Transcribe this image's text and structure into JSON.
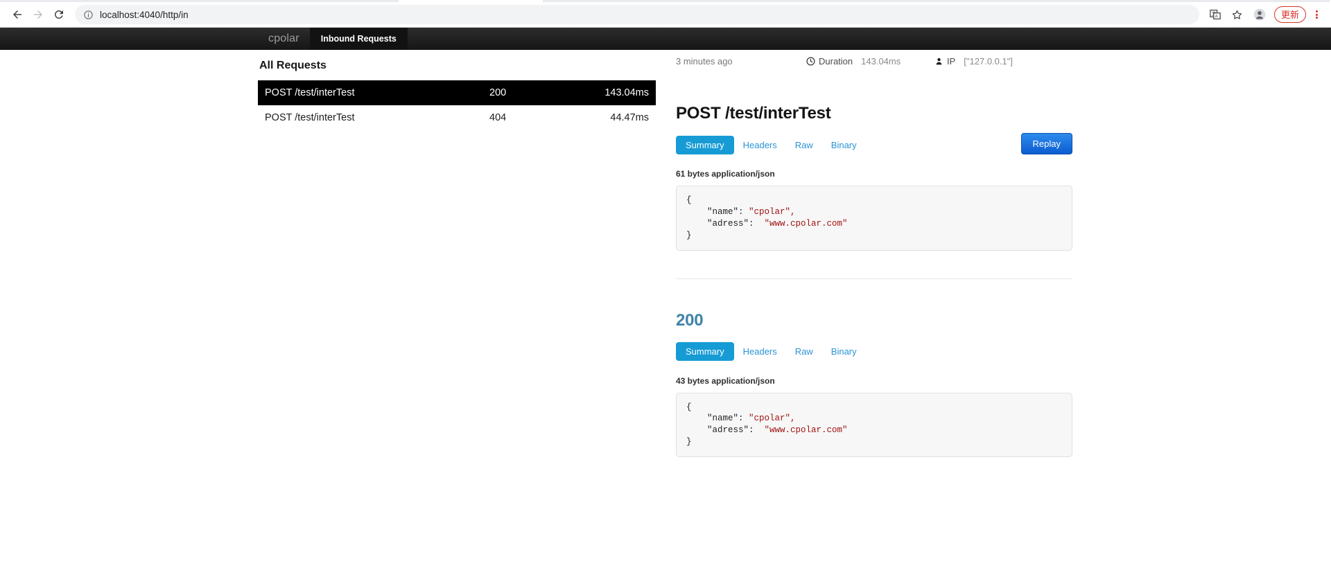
{
  "browser": {
    "url": "localhost:4040/http/in",
    "back_label": "Back",
    "forward_label": "Forward",
    "reload_label": "Reload",
    "site_info_label": "View site information",
    "translate_label": "Translate this page",
    "bookmark_label": "Bookmark this tab",
    "profile_label": "Profile",
    "update_label": "更新",
    "menu_label": "Customize and control"
  },
  "navbar": {
    "brand": "cpolar",
    "tab_inbound": "Inbound Requests"
  },
  "requests": {
    "title": "All Requests",
    "rows": [
      {
        "path": "POST /test/interTest",
        "status": "200",
        "duration": "143.04ms",
        "selected": true
      },
      {
        "path": "POST /test/interTest",
        "status": "404",
        "duration": "44.47ms",
        "selected": false
      }
    ]
  },
  "detail": {
    "meta": {
      "when": "3 minutes ago",
      "duration_key": "Duration",
      "duration_value": "143.04ms",
      "ip_key": "IP",
      "ip_value": "[\"127.0.0.1\"]"
    },
    "request": {
      "title": "POST /test/interTest",
      "tabs": [
        "Summary",
        "Headers",
        "Raw",
        "Binary"
      ],
      "replay_label": "Replay",
      "bytes_label": "61 bytes application/json",
      "body_lines": [
        {
          "text": "{",
          "type": "plain"
        },
        {
          "key": "    \"name\":",
          "value": " \"cpolar\",",
          "type": "pair"
        },
        {
          "key": "    \"adress\":",
          "value": "  \"www.cpolar.com\"",
          "type": "pair"
        },
        {
          "text": "}",
          "type": "plain"
        }
      ]
    },
    "response": {
      "title": "200",
      "tabs": [
        "Summary",
        "Headers",
        "Raw",
        "Binary"
      ],
      "bytes_label": "43 bytes application/json",
      "body_lines": [
        {
          "text": "{",
          "type": "plain"
        },
        {
          "key": "    \"name\":",
          "value": " \"cpolar\",",
          "type": "pair"
        },
        {
          "key": "    \"adress\":",
          "value": "  \"www.cpolar.com\"",
          "type": "pair"
        },
        {
          "text": "}",
          "type": "plain"
        }
      ]
    }
  },
  "colors": {
    "tab_active": "#169bd5",
    "tab_link": "#2a93d5",
    "replay": "#0c5cd0",
    "status_ok": "#3d82a8",
    "selected_row": "#000000",
    "update_red": "#d93025",
    "json_string": "#a11111"
  }
}
